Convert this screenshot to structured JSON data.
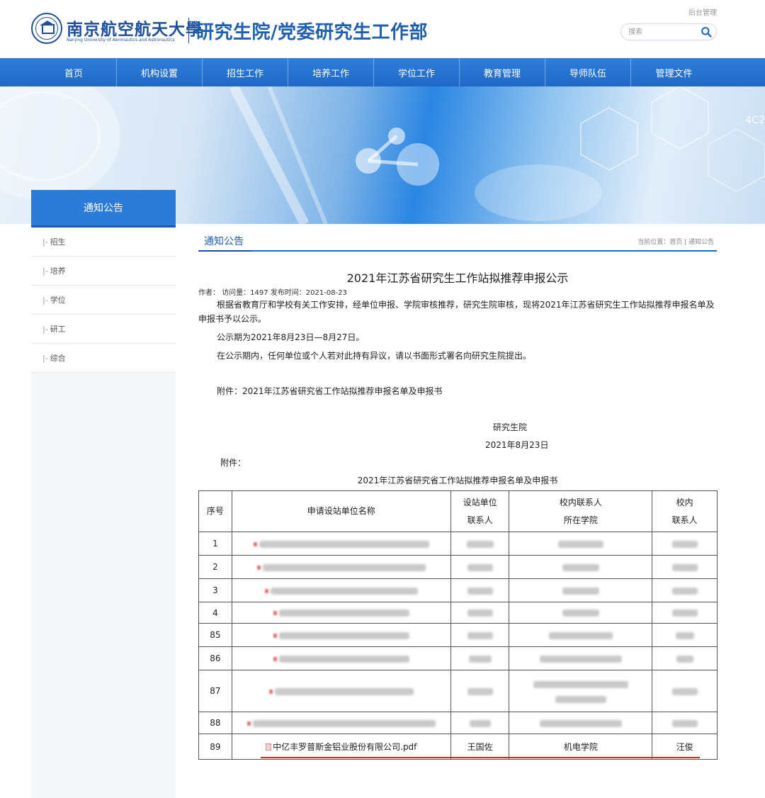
{
  "header": {
    "university_name": "南京航空航天大學",
    "university_name_en": "Nanjing University of Aeronautics and Astronautics",
    "department": "研究生院/党委研究生工作部",
    "admin_link": "后台管理",
    "search_placeholder": "搜索"
  },
  "nav": {
    "items": [
      "首页",
      "机构设置",
      "招生工作",
      "培养工作",
      "学位工作",
      "教育管理",
      "导师队伍",
      "管理文件"
    ]
  },
  "banner": {
    "code": "4C2"
  },
  "sidebar": {
    "title": "通知公告",
    "items": [
      "招生",
      "培养",
      "学位",
      "研工",
      "综合"
    ],
    "dash": "|-"
  },
  "breadcrumb": {
    "section": "通知公告",
    "path": "当前位置：首页 | 通知公告"
  },
  "article": {
    "title": "2021年江苏省研究生工作站拟推荐申报公示",
    "meta": "作者：  访问量：1497 发布时间：2021-08-23",
    "para1": "根据省教育厅和学校有关工作安排，经单位申报、学院审核推荐，研究生院审核，现将2021年江苏省研究生工作站拟推荐申报名单及申报书予以公示。",
    "para2": "公示期为2021年8月23日—8月27日。",
    "para3": "在公示期内，任何单位或个人若对此持有异议，请以书面形式署名向研究生院提出。",
    "para4": "附件：2021年江苏省研究省工作站拟推荐申报名单及申报书",
    "signature_org": "研究生院",
    "signature_date": "2021年8月23日",
    "attachment_label": "附件：",
    "table_caption": "2021年江苏省研究省工作站拟推荐申报名单及申报书"
  },
  "table": {
    "headers": {
      "no": "序号",
      "unit": "申请设站单位名称",
      "unit_contact_1": "设站单位",
      "unit_contact_2": "联系人",
      "school_contact_1": "校内联系人",
      "school_contact_2": "所在学院",
      "inner_contact_1": "校内",
      "inner_contact_2": "联系人"
    },
    "rows": [
      {
        "no": "1"
      },
      {
        "no": "2"
      },
      {
        "no": "3"
      },
      {
        "no": "4"
      },
      {
        "no": "85"
      },
      {
        "no": "86"
      },
      {
        "no": "87"
      },
      {
        "no": "88"
      },
      {
        "no": "89",
        "unit": "中亿丰罗普斯金铝业股份有限公司.pdf",
        "unit_contact": "王国佐",
        "school": "机电学院",
        "inner_contact": "汪俊"
      }
    ]
  },
  "colors": {
    "brand_blue": "#1f5fae",
    "nav_blue": "#2a7cd8",
    "highlight_red": "#e02020"
  }
}
